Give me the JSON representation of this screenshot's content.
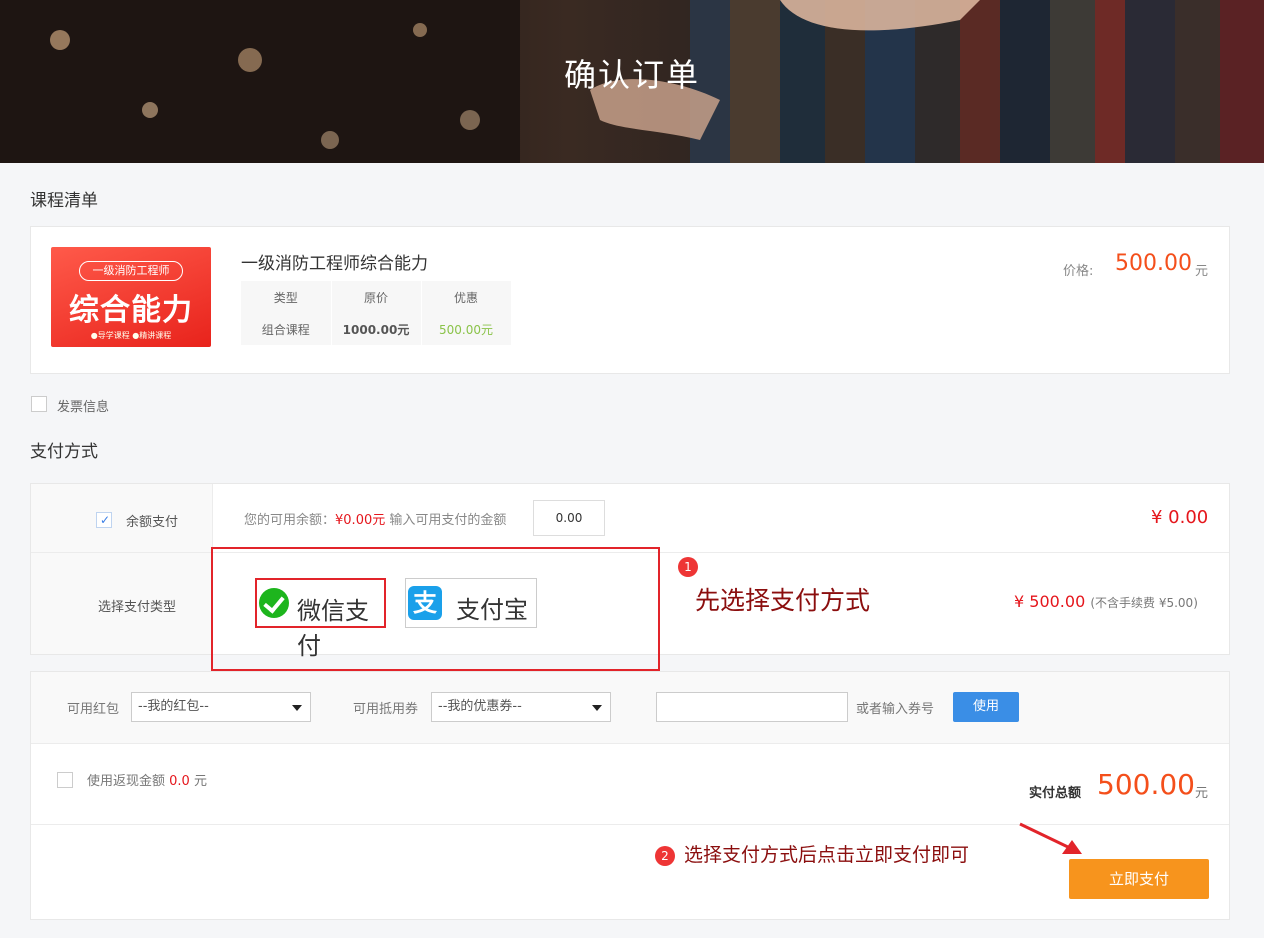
{
  "banner": {
    "title": "确认订单"
  },
  "course_section": {
    "title": "课程清单"
  },
  "course": {
    "thumb_tag": "一级消防工程师",
    "thumb_big": "综合能力",
    "thumb_small": "●导学课程  ●精讲课程",
    "name": "一级消防工程师综合能力",
    "headers": [
      "类型",
      "原价",
      "优惠"
    ],
    "values": [
      "组合课程",
      "1000.00元",
      "500.00元"
    ],
    "price_label": "价格:",
    "price": "500.00",
    "price_unit": "元"
  },
  "invoice": {
    "label": "发票信息",
    "checked": false
  },
  "payment_section": {
    "title": "支付方式"
  },
  "balance": {
    "label": "余额支付",
    "checked": true,
    "prefix": "您的可用余额：",
    "available": "¥0.00元",
    "prompt": "输入可用支付的金额",
    "input_value": "0.00",
    "amount": "¥ 0.00"
  },
  "pay_type": {
    "label": "选择支付类型",
    "wechat": "微信支付",
    "alipay_logo": "支",
    "alipay": "支付宝",
    "amount": "¥ 500.00",
    "fee_note": "(不含手续费 ¥5.00)"
  },
  "annotations": {
    "step1_num": "1",
    "step1": "先选择支付方式",
    "step2_num": "2",
    "step2": "选择支付方式后点击立即支付即可"
  },
  "coupons": {
    "redpacket_label": "可用红包",
    "redpacket_value": "--我的红包--",
    "voucher_label": "可用抵用券",
    "voucher_value": "--我的优惠券--",
    "code_placeholder": "",
    "code_label": "或者输入券号",
    "use_button": "使用"
  },
  "cashback": {
    "label": "使用返现金额",
    "amount": "0.0",
    "unit": "元",
    "checked": false
  },
  "total": {
    "label": "实付总额",
    "value": "500.00",
    "unit": "元"
  },
  "pay_button": "立即支付",
  "colors": {
    "accent_orange": "#f44f1b",
    "pay_button": "#f7941d",
    "use_button": "#3a8ee6",
    "annotation_red": "#e2242a",
    "annotation_text": "#8b0e0e"
  }
}
